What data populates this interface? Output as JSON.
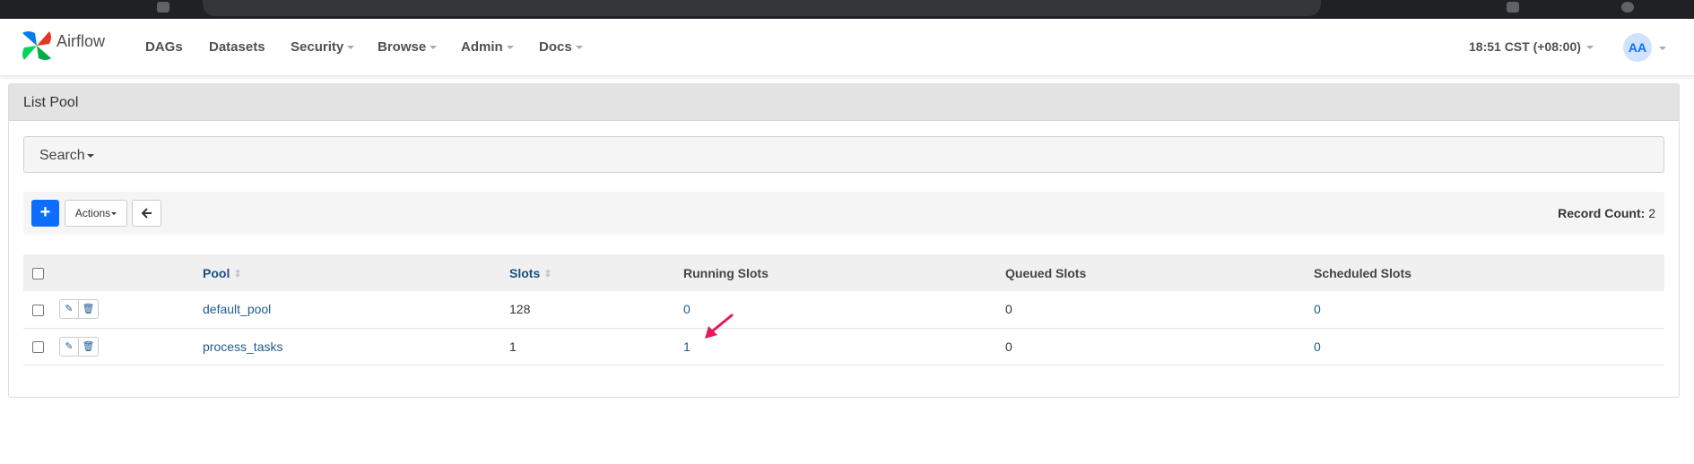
{
  "brand": {
    "name": "Airflow"
  },
  "nav": {
    "items": [
      {
        "label": "DAGs",
        "dropdown": false
      },
      {
        "label": "Datasets",
        "dropdown": false
      },
      {
        "label": "Security",
        "dropdown": true
      },
      {
        "label": "Browse",
        "dropdown": true
      },
      {
        "label": "Admin",
        "dropdown": true
      },
      {
        "label": "Docs",
        "dropdown": true
      }
    ],
    "time": "18:51 CST (+08:00)",
    "user_initials": "AA"
  },
  "panel": {
    "title": "List Pool",
    "search_label": "Search",
    "actions_label": "Actions",
    "add_icon": "plus-icon",
    "back_icon": "arrow-left-icon",
    "record_count_label": "Record Count:",
    "record_count_value": "2"
  },
  "table": {
    "headers": {
      "pool": "Pool",
      "slots": "Slots",
      "running": "Running Slots",
      "queued": "Queued Slots",
      "scheduled": "Scheduled Slots"
    },
    "rows": [
      {
        "pool": "default_pool",
        "slots": "128",
        "running": "0",
        "queued": "0",
        "scheduled": "0"
      },
      {
        "pool": "process_tasks",
        "slots": "1",
        "running": "1",
        "queued": "0",
        "scheduled": "0"
      }
    ]
  },
  "colors": {
    "primary": "#0d6efd",
    "link": "#1f5b8e",
    "annotation_arrow": "#e8195a",
    "navbar_text": "#51504f"
  }
}
